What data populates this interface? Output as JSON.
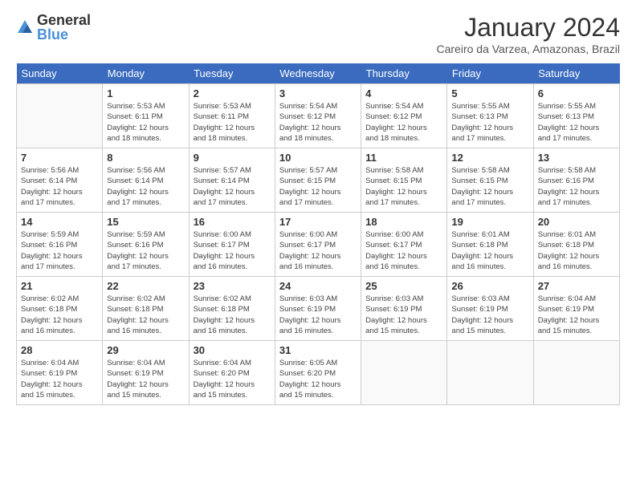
{
  "header": {
    "logo_general": "General",
    "logo_blue": "Blue",
    "title": "January 2024",
    "subtitle": "Careiro da Varzea, Amazonas, Brazil"
  },
  "weekdays": [
    "Sunday",
    "Monday",
    "Tuesday",
    "Wednesday",
    "Thursday",
    "Friday",
    "Saturday"
  ],
  "weeks": [
    [
      {
        "day": "",
        "info": ""
      },
      {
        "day": "1",
        "info": "Sunrise: 5:53 AM\nSunset: 6:11 PM\nDaylight: 12 hours\nand 18 minutes."
      },
      {
        "day": "2",
        "info": "Sunrise: 5:53 AM\nSunset: 6:11 PM\nDaylight: 12 hours\nand 18 minutes."
      },
      {
        "day": "3",
        "info": "Sunrise: 5:54 AM\nSunset: 6:12 PM\nDaylight: 12 hours\nand 18 minutes."
      },
      {
        "day": "4",
        "info": "Sunrise: 5:54 AM\nSunset: 6:12 PM\nDaylight: 12 hours\nand 18 minutes."
      },
      {
        "day": "5",
        "info": "Sunrise: 5:55 AM\nSunset: 6:13 PM\nDaylight: 12 hours\nand 17 minutes."
      },
      {
        "day": "6",
        "info": "Sunrise: 5:55 AM\nSunset: 6:13 PM\nDaylight: 12 hours\nand 17 minutes."
      }
    ],
    [
      {
        "day": "7",
        "info": "Sunrise: 5:56 AM\nSunset: 6:14 PM\nDaylight: 12 hours\nand 17 minutes."
      },
      {
        "day": "8",
        "info": "Sunrise: 5:56 AM\nSunset: 6:14 PM\nDaylight: 12 hours\nand 17 minutes."
      },
      {
        "day": "9",
        "info": "Sunrise: 5:57 AM\nSunset: 6:14 PM\nDaylight: 12 hours\nand 17 minutes."
      },
      {
        "day": "10",
        "info": "Sunrise: 5:57 AM\nSunset: 6:15 PM\nDaylight: 12 hours\nand 17 minutes."
      },
      {
        "day": "11",
        "info": "Sunrise: 5:58 AM\nSunset: 6:15 PM\nDaylight: 12 hours\nand 17 minutes."
      },
      {
        "day": "12",
        "info": "Sunrise: 5:58 AM\nSunset: 6:15 PM\nDaylight: 12 hours\nand 17 minutes."
      },
      {
        "day": "13",
        "info": "Sunrise: 5:58 AM\nSunset: 6:16 PM\nDaylight: 12 hours\nand 17 minutes."
      }
    ],
    [
      {
        "day": "14",
        "info": "Sunrise: 5:59 AM\nSunset: 6:16 PM\nDaylight: 12 hours\nand 17 minutes."
      },
      {
        "day": "15",
        "info": "Sunrise: 5:59 AM\nSunset: 6:16 PM\nDaylight: 12 hours\nand 17 minutes."
      },
      {
        "day": "16",
        "info": "Sunrise: 6:00 AM\nSunset: 6:17 PM\nDaylight: 12 hours\nand 16 minutes."
      },
      {
        "day": "17",
        "info": "Sunrise: 6:00 AM\nSunset: 6:17 PM\nDaylight: 12 hours\nand 16 minutes."
      },
      {
        "day": "18",
        "info": "Sunrise: 6:00 AM\nSunset: 6:17 PM\nDaylight: 12 hours\nand 16 minutes."
      },
      {
        "day": "19",
        "info": "Sunrise: 6:01 AM\nSunset: 6:18 PM\nDaylight: 12 hours\nand 16 minutes."
      },
      {
        "day": "20",
        "info": "Sunrise: 6:01 AM\nSunset: 6:18 PM\nDaylight: 12 hours\nand 16 minutes."
      }
    ],
    [
      {
        "day": "21",
        "info": "Sunrise: 6:02 AM\nSunset: 6:18 PM\nDaylight: 12 hours\nand 16 minutes."
      },
      {
        "day": "22",
        "info": "Sunrise: 6:02 AM\nSunset: 6:18 PM\nDaylight: 12 hours\nand 16 minutes."
      },
      {
        "day": "23",
        "info": "Sunrise: 6:02 AM\nSunset: 6:18 PM\nDaylight: 12 hours\nand 16 minutes."
      },
      {
        "day": "24",
        "info": "Sunrise: 6:03 AM\nSunset: 6:19 PM\nDaylight: 12 hours\nand 16 minutes."
      },
      {
        "day": "25",
        "info": "Sunrise: 6:03 AM\nSunset: 6:19 PM\nDaylight: 12 hours\nand 15 minutes."
      },
      {
        "day": "26",
        "info": "Sunrise: 6:03 AM\nSunset: 6:19 PM\nDaylight: 12 hours\nand 15 minutes."
      },
      {
        "day": "27",
        "info": "Sunrise: 6:04 AM\nSunset: 6:19 PM\nDaylight: 12 hours\nand 15 minutes."
      }
    ],
    [
      {
        "day": "28",
        "info": "Sunrise: 6:04 AM\nSunset: 6:19 PM\nDaylight: 12 hours\nand 15 minutes."
      },
      {
        "day": "29",
        "info": "Sunrise: 6:04 AM\nSunset: 6:19 PM\nDaylight: 12 hours\nand 15 minutes."
      },
      {
        "day": "30",
        "info": "Sunrise: 6:04 AM\nSunset: 6:20 PM\nDaylight: 12 hours\nand 15 minutes."
      },
      {
        "day": "31",
        "info": "Sunrise: 6:05 AM\nSunset: 6:20 PM\nDaylight: 12 hours\nand 15 minutes."
      },
      {
        "day": "",
        "info": ""
      },
      {
        "day": "",
        "info": ""
      },
      {
        "day": "",
        "info": ""
      }
    ]
  ]
}
